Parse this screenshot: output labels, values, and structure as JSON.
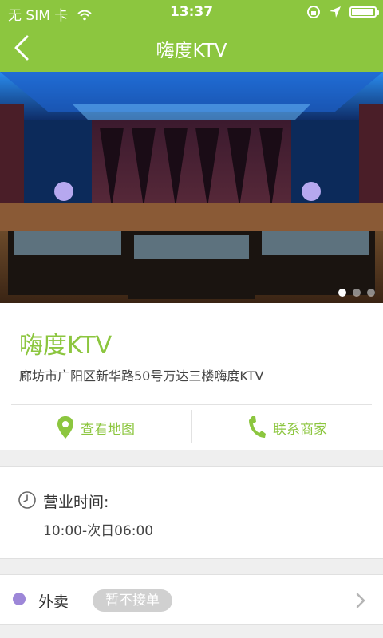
{
  "status_bar": {
    "carrier": "无 SIM 卡",
    "time": "13:37"
  },
  "nav": {
    "title": "嗨度KTV"
  },
  "gallery": {
    "page_count": 3,
    "active_index": 0
  },
  "store": {
    "name": "嗨度KTV",
    "address": "廊坊市广阳区新华路50号万达三楼嗨度KTV"
  },
  "actions": {
    "map_label": "查看地图",
    "call_label": "联系商家"
  },
  "hours": {
    "label": "营业时间:",
    "value": "10:00-次日06:00"
  },
  "takeout": {
    "label": "外卖",
    "badge": "暂不接单"
  },
  "colors": {
    "accent": "#8cc63f",
    "bullet": "#9d87d8",
    "badge_bg": "#d0d0d0"
  }
}
